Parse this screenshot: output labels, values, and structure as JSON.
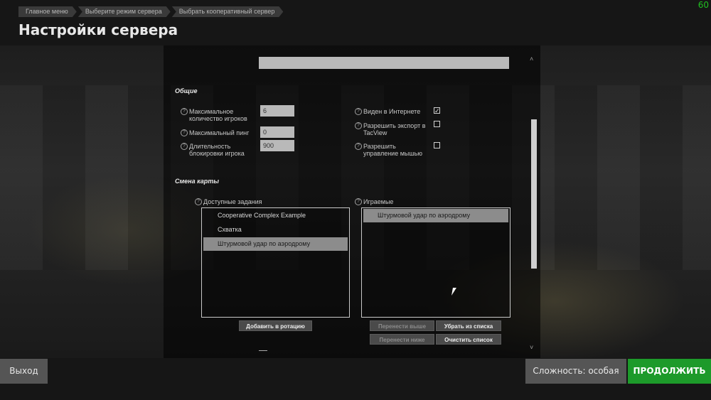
{
  "breadcrumb": [
    "Главное меню",
    "Выберите режим сервера",
    "Выбрать кооперативный сервер"
  ],
  "fps": "60",
  "page_title": "Настройки сервера",
  "server_name": "",
  "general": {
    "title": "Общие",
    "max_players_label": "Максимальное количество игроков",
    "max_players_value": "6",
    "max_ping_label": "Максимальный пинг",
    "max_ping_value": "0",
    "ban_duration_label": "Длительность блокировки игрока",
    "ban_duration_value": "900",
    "visible_internet_label": "Виден в Интернете",
    "visible_internet_checked": true,
    "tacview_label": "Разрешить экспорт в TacView",
    "tacview_checked": false,
    "mouse_label": "Разрешить управление мышью",
    "mouse_checked": false
  },
  "map_change": {
    "title": "Смена карты",
    "available_label": "Доступные задания",
    "available": [
      "Cooperative Complex Example",
      "Схватка",
      "Штурмовой удар по аэродрому"
    ],
    "available_selected": 2,
    "playing_label": "Играемые",
    "playing": [
      "Штурмовой удар по аэродрому"
    ],
    "playing_selected": 0
  },
  "buttons": {
    "add_rotation": "Добавить в ротацию",
    "move_up": "Перенести выше",
    "remove": "Убрать из списка",
    "move_down": "Перенести ниже",
    "clear": "Очистить список"
  },
  "footer": {
    "exit": "Выход",
    "difficulty": "Сложность: особая",
    "continue": "ПРОДОЛЖИТЬ"
  },
  "colors": {
    "accent": "#1d9a2a",
    "fps": "#20c020"
  }
}
